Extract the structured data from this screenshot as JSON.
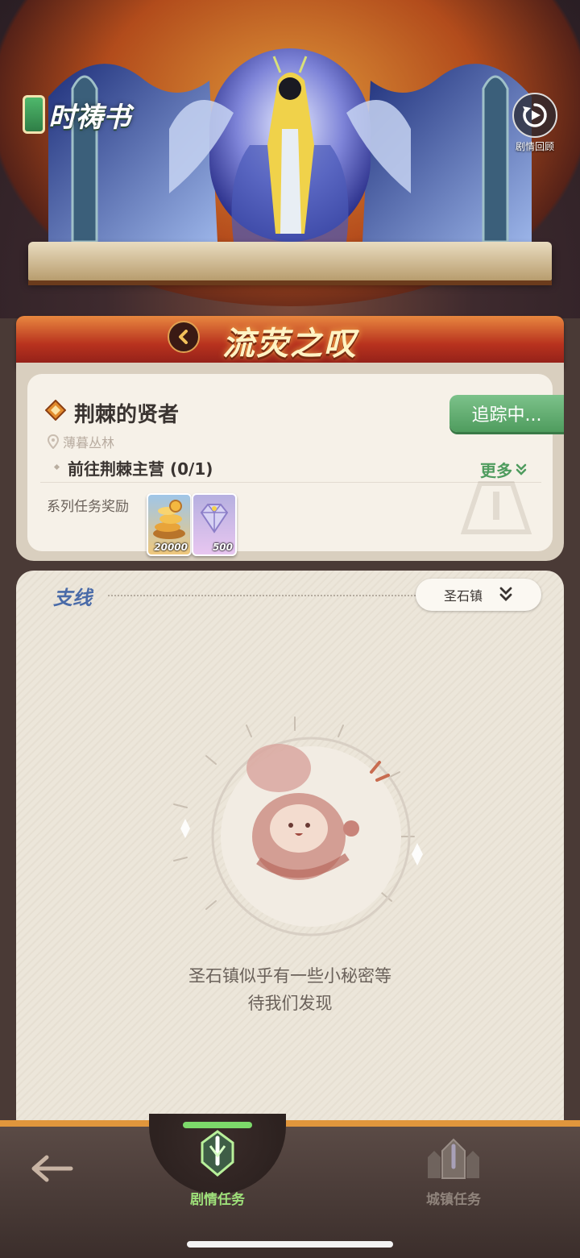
{
  "header": {
    "logo_text": "时祷书",
    "replay_label": "剧情回顾"
  },
  "chapter": {
    "title": "流荧之叹"
  },
  "main_quest": {
    "title": "荆棘的贤者",
    "location": "薄暮丛林",
    "track_label": "追踪中...",
    "objective": "前往荆棘主营 (0/1)",
    "more_label": "更多",
    "reward_label": "系列任务奖励",
    "rewards": [
      {
        "icon": "gold-coins-icon",
        "amount": "20000"
      },
      {
        "icon": "diamond-icon",
        "amount": "500"
      }
    ]
  },
  "side_quests": {
    "title": "支线",
    "town_filter": "圣石镇",
    "empty_line1": "圣石镇似乎有一些小秘密等",
    "empty_line2": "待我们发现"
  },
  "bottom_nav": {
    "back_icon": "back-arrow-icon",
    "story_label": "剧情任务",
    "town_label": "城镇任务",
    "active_color": "#9ee07a"
  },
  "colors": {
    "accent_green": "#4f9c5e",
    "banner_red": "#b8321e",
    "side_title_blue": "#4a6ba8"
  }
}
